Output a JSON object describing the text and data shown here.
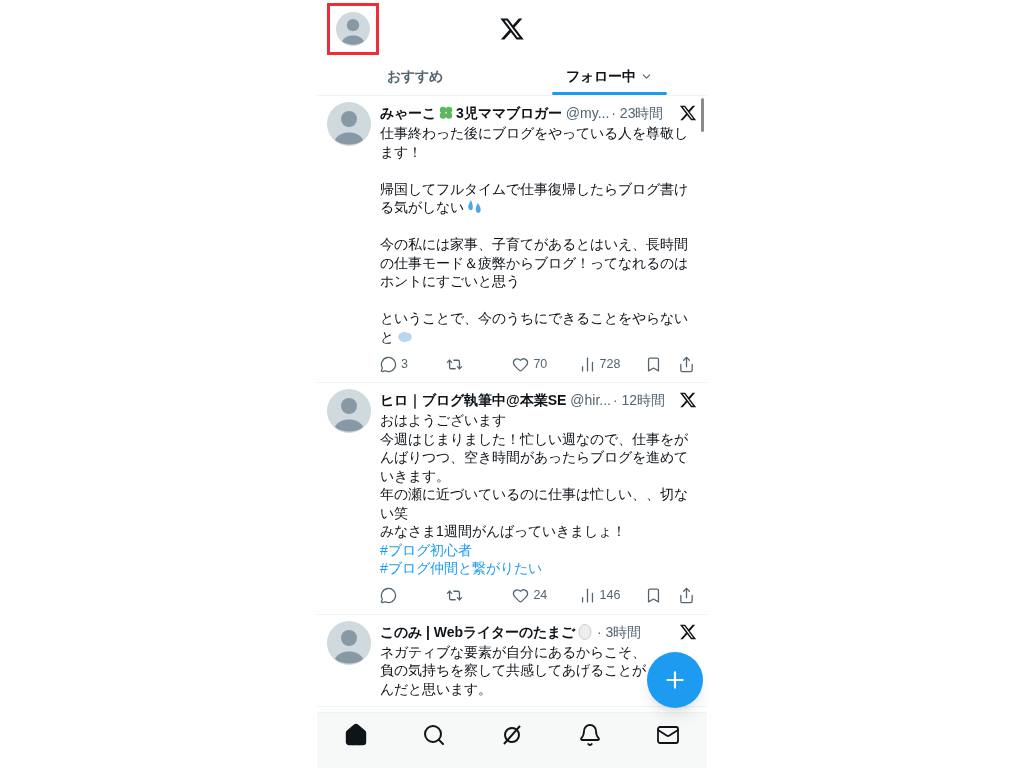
{
  "header": {
    "avatar_highlighted": true
  },
  "tabs": [
    {
      "label": "おすすめ",
      "selected": false,
      "dropdown": false
    },
    {
      "label": "フォロー中",
      "selected": true,
      "dropdown": true
    }
  ],
  "tweets": [
    {
      "name": "みゃーこ",
      "name_icon": {
        "kind": "clover"
      },
      "name_suffix": "3児ママブロガー",
      "handle": "@my...",
      "time": "· 23時間",
      "paragraphs": [
        {
          "lines": [
            {
              "text": "仕事終わった後にブログをやっている人を尊敬し"
            },
            {
              "text": "ます！"
            }
          ]
        },
        {
          "lines": [
            {
              "text": "帰国してフルタイムで仕事復帰したらブログ書け"
            },
            {
              "text": "る気がしない",
              "trailing_icon": {
                "kind": "droplets"
              }
            }
          ]
        },
        {
          "lines": [
            {
              "text": "今の私には家事、子育てがあるとはいえ、長時間"
            },
            {
              "text": "の仕事モード＆疲弊からブログ！ってなれるのは"
            },
            {
              "text": "ホントにすごいと思う"
            }
          ]
        },
        {
          "lines": [
            {
              "text": "ということで、今のうちにできることをやらない"
            },
            {
              "text": "と",
              "trailing_icon": {
                "kind": "dash"
              }
            }
          ]
        }
      ],
      "actions": [
        {
          "kind": "reply",
          "count": "3"
        },
        {
          "kind": "repost"
        },
        {
          "kind": "like",
          "count": "70"
        },
        {
          "kind": "views",
          "count": "728"
        },
        {
          "kind": "bookmark"
        },
        {
          "kind": "share"
        }
      ]
    },
    {
      "name": "ヒロ｜ブログ執筆中@本業SE",
      "handle": "@hir...",
      "time": "· 12時間",
      "paragraphs": [
        {
          "lines": [
            {
              "text": "おはようございます"
            },
            {
              "text": "今週はじまりました！忙しい週なので、仕事をが"
            },
            {
              "text": "んばりつつ、空き時間があったらブログを進めて"
            },
            {
              "text": "いきます。"
            },
            {
              "text": "年の瀬に近づいているのに仕事は忙しい、、切な"
            },
            {
              "text": "い笑"
            },
            {
              "text": "みなさま1週間がんばっていきましょ！"
            },
            {
              "text": "#ブログ初心者",
              "link": true
            },
            {
              "text": "#ブログ仲間と繋がりたい",
              "link": true
            }
          ]
        }
      ],
      "actions": [
        {
          "kind": "reply"
        },
        {
          "kind": "repost"
        },
        {
          "kind": "like",
          "count": "24"
        },
        {
          "kind": "views",
          "count": "146"
        },
        {
          "kind": "bookmark"
        },
        {
          "kind": "share"
        }
      ]
    },
    {
      "name": "このみ | Webライターのたまご",
      "name_icon": {
        "kind": "egg"
      },
      "time": "· 3時間",
      "paragraphs": [
        {
          "lines": [
            {
              "text": "ネガティブな要素が自分にあるからこそ、"
            },
            {
              "text": "負の気持ちを察して共感してあげることが"
            },
            {
              "text": "んだと思います。"
            }
          ]
        }
      ]
    }
  ],
  "nav": [
    {
      "kind": "home",
      "selected": true
    },
    {
      "kind": "search",
      "selected": false
    },
    {
      "kind": "grok",
      "selected": false
    },
    {
      "kind": "notifications",
      "selected": false
    },
    {
      "kind": "messages",
      "selected": false
    }
  ]
}
